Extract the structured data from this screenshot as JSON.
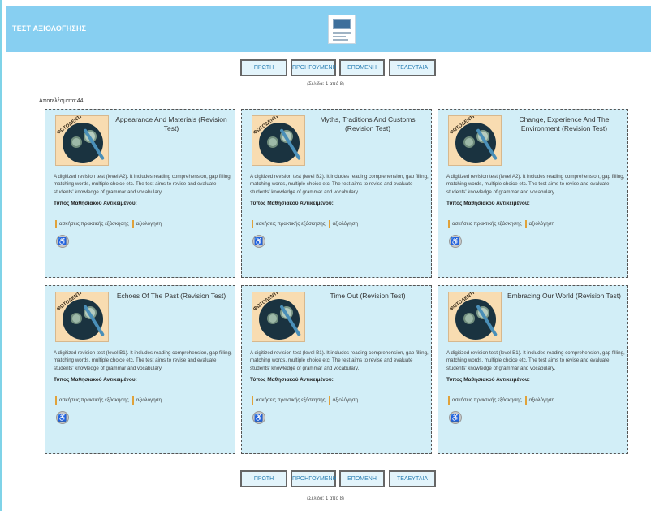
{
  "header": {
    "title": "ΤΕΣΤ ΑΞΙΟΛΟΓΗΣΗΣ",
    "logo_icon": "site-logo-icon"
  },
  "pager": {
    "first": "ΠΡΩΤΗ",
    "prev": "ΠΡΟΗΓΟΥΜΕΝΗ",
    "next": "ΕΠΟΜΕΝΗ",
    "last": "ΤΕΛΕΥΤΑΙΑ",
    "page_info": "(Σελίδα: 1 από 8)"
  },
  "results_label": "Αποτελέσματα:44",
  "cards": [
    {
      "title": "Appearance And Materials (Revision Test)",
      "description": "A digitized revision test (level A2). It includes reading comprehension, gap filling, matching words, multiple choice etc. The test aims to revise and evaluate students' knowledge of grammar and vocabulary.",
      "type_label": "Τύπος Μαθησιακού Αντικειμένου:",
      "tags": [
        "ασκήσεις πρακτικής εξάσκησης",
        "αξιολόγηση"
      ],
      "badge": "ΦΩΤΟΔΕΝΤΡΟ"
    },
    {
      "title": "Myths, Traditions And Customs (Revision Test)",
      "description": "A digitized revision test (level B2). It includes reading comprehension, gap filling, matching words, multiple choice etc. The test aims to revise and evaluate students' knowledge of grammar and vocabulary.",
      "type_label": "Τύπος Μαθησιακού Αντικειμένου:",
      "tags": [
        "ασκήσεις πρακτικής εξάσκησης",
        "αξιολόγηση"
      ],
      "badge": "ΦΩΤΟΔΕΝΤΡΟ"
    },
    {
      "title": "Change, Experience And The Environment (Revision Test)",
      "description": "A digitized revision test (level A2). It includes reading comprehension, gap filling, matching words, multiple choice etc. The test aims to revise and evaluate students' knowledge of grammar and vocabulary.",
      "type_label": "Τύπος Μαθησιακού Αντικειμένου:",
      "tags": [
        "ασκήσεις πρακτικής εξάσκησης",
        "αξιολόγηση"
      ],
      "badge": "ΦΩΤΟΔΕΝΤΡΟ"
    },
    {
      "title": "Echoes Of The Past (Revision Test)",
      "description": "A digitized revision test (level B1). It includes reading comprehension, gap filling, matching words, multiple choice etc. The test aims to revise and evaluate students' knowledge of grammar and vocabulary.",
      "type_label": "Τύπος Μαθησιακού Αντικειμένου:",
      "tags": [
        "ασκήσεις πρακτικής εξάσκησης",
        "αξιολόγηση"
      ],
      "badge": "ΦΩΤΟΔΕΝΤΡΟ"
    },
    {
      "title": "Time Out (Revision Test)",
      "description": "A digitized revision test (level B1). It includes reading comprehension, gap filling, matching words, multiple choice etc. The test aims to revise and evaluate students' knowledge of grammar and vocabulary.",
      "type_label": "Τύπος Μαθησιακού Αντικειμένου:",
      "tags": [
        "ασκήσεις πρακτικής εξάσκησης",
        "αξιολόγηση"
      ],
      "badge": "ΦΩΤΟΔΕΝΤΡΟ"
    },
    {
      "title": "Embracing Our World (Revision Test)",
      "description": "A digitized revision test (level B1). It includes reading comprehension, gap filling, matching words, multiple choice etc. The test aims to revise and evaluate students' knowledge of grammar and vocabulary.",
      "type_label": "Τύπος Μαθησιακού Αντικειμένου:",
      "tags": [
        "ασκήσεις πρακτικής εξάσκησης",
        "αξιολόγηση"
      ],
      "badge": "ΦΩΤΟΔΕΝΤΡΟ"
    }
  ],
  "colors": {
    "header_bg": "#87cff1",
    "card_bg": "#d2eef7",
    "tag_accent": "#e0a23a",
    "button_text": "#2a7fb3"
  }
}
